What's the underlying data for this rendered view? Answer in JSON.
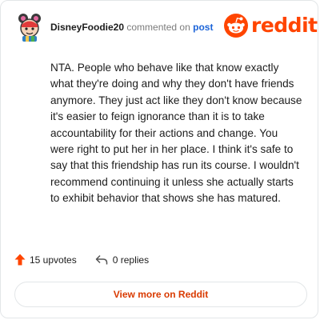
{
  "header": {
    "author": "DisneyFoodie20",
    "commented_text": "commented on",
    "post_link": "post",
    "logo_text": "reddit"
  },
  "comment": {
    "body": "NTA. People who behave like that know exactly what they're doing and why they don't have friends anymore. They just act like they don't know because it's easier to feign ignorance than it is to take accountability for their actions and change. You were right to put her in her place. I think it's safe to say that this friendship has run its course. I wouldn't recommend continuing it unless she actually starts to exhibit behavior that shows she has matured."
  },
  "actions": {
    "upvotes_label": "15 upvotes",
    "replies_label": "0 replies"
  },
  "footer": {
    "view_button_label": "View more on Reddit"
  },
  "icons": {
    "avatar": "cartoon-character-avatar-icon",
    "logo": "reddit-snoo-icon",
    "upvote": "upvote-arrow-icon",
    "reply": "reply-arrow-icon"
  },
  "colors": {
    "brand": "#ff4500",
    "link": "#1c64d8",
    "upvote": "#ff4500",
    "button_text": "#d93a00",
    "muted_text": "#7c7c7c",
    "border": "#e3e6e8"
  }
}
